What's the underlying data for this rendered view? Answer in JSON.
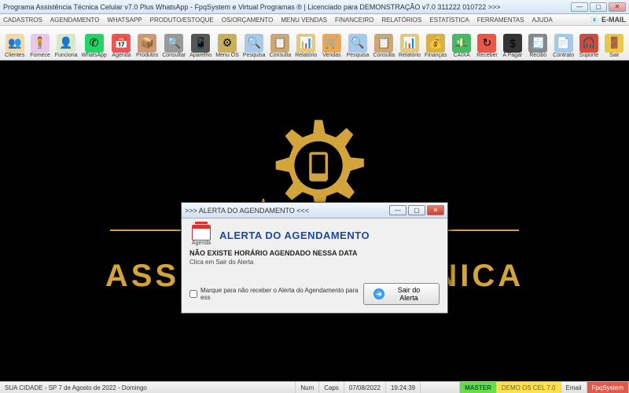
{
  "window": {
    "title": "Programa Assistência Técnica Celular v7.0 Plus WhatsApp - FpqSystem e Virtual Programas ® | Licenciado para  DEMONSTRAÇÃO v7.0 311222 010722 >>>"
  },
  "menu": {
    "items": [
      "CADASTROS",
      "AGENDAMENTO",
      "WHATSAPP",
      "PRODUTO/ESTOQUE",
      "OS/ORÇAMENTO",
      "MENU VENDAS",
      "FINANCEIRO",
      "RELATÓRIOS",
      "ESTATÍSTICA",
      "FERRAMENTAS",
      "AJUDA"
    ],
    "email": "E-MAIL"
  },
  "toolbar": {
    "items": [
      {
        "label": "Clientes",
        "icon": "👥",
        "bg": "#f6d7a7"
      },
      {
        "label": "Fornece",
        "icon": "🧍",
        "bg": "#e8c8e8"
      },
      {
        "label": "Funciona",
        "icon": "👤",
        "bg": "#d8e8c8"
      },
      {
        "label": "WhatsApp",
        "icon": "✆",
        "bg": "#25d366"
      },
      {
        "label": "Agenda",
        "icon": "📅",
        "bg": "#e55"
      },
      {
        "label": "Produtos",
        "icon": "📦",
        "bg": "#c97"
      },
      {
        "label": "Consultar",
        "icon": "🔍",
        "bg": "#999"
      },
      {
        "label": "Aparelho",
        "icon": "📱",
        "bg": "#555"
      },
      {
        "label": "Menu OS",
        "icon": "⚙",
        "bg": "#c8b060"
      },
      {
        "label": "Pesquisa",
        "icon": "🔍",
        "bg": "#aac8e8"
      },
      {
        "label": "Consulta",
        "icon": "📋",
        "bg": "#c8a878"
      },
      {
        "label": "Relatório",
        "icon": "📊",
        "bg": "#e8c878"
      },
      {
        "label": "Vendas",
        "icon": "🛒",
        "bg": "#e8a858"
      },
      {
        "label": "Pesquisa",
        "icon": "🔍",
        "bg": "#aac8e8"
      },
      {
        "label": "Consulta",
        "icon": "📋",
        "bg": "#c8a878"
      },
      {
        "label": "Relatório",
        "icon": "📊",
        "bg": "#e8c878"
      },
      {
        "label": "Finanças",
        "icon": "💰",
        "bg": "#d8b048"
      },
      {
        "label": "CAIXA",
        "icon": "💵",
        "bg": "#48b868"
      },
      {
        "label": "Receber",
        "icon": "↻",
        "bg": "#e85848"
      },
      {
        "label": "A Pagar",
        "icon": "$",
        "bg": "#333"
      },
      {
        "label": "Recibo",
        "icon": "🧾",
        "bg": "#888"
      },
      {
        "label": "Contrato",
        "icon": "📄",
        "bg": "#a8c8e8"
      },
      {
        "label": "Suporte",
        "icon": "🎧",
        "bg": "#d84838"
      },
      {
        "label": "Sair",
        "icon": "🚪",
        "bg": "#e8c848"
      }
    ]
  },
  "brand": {
    "text": "ASSISTÊNCIA TÉCNICA",
    "accent": "#d4a43c"
  },
  "dialog": {
    "title": ">>> ALERTA DO AGENDAMENTO <<<",
    "icon_caption": "Agenda",
    "heading": "ALERTA DO AGENDAMENTO",
    "message1": "NÃO EXISTE HORÁRIO AGENDADO NESSA DATA",
    "message2": "Clica em Sair do Alerta",
    "checkbox_label": "Marque para não receber o Alerta do Agendamento para ess",
    "button_label": "Sair do Alerta"
  },
  "status": {
    "location": "SUA CIDADE - SP  7 de Agosto de 2022 - Domingo",
    "num": "Num",
    "caps": "Caps",
    "date": "07/08/2022",
    "time": "19:24:39",
    "user": "MASTER",
    "db": "DEMO OS CEL 7.0",
    "email": "Email",
    "brand": "FpqSystem"
  }
}
